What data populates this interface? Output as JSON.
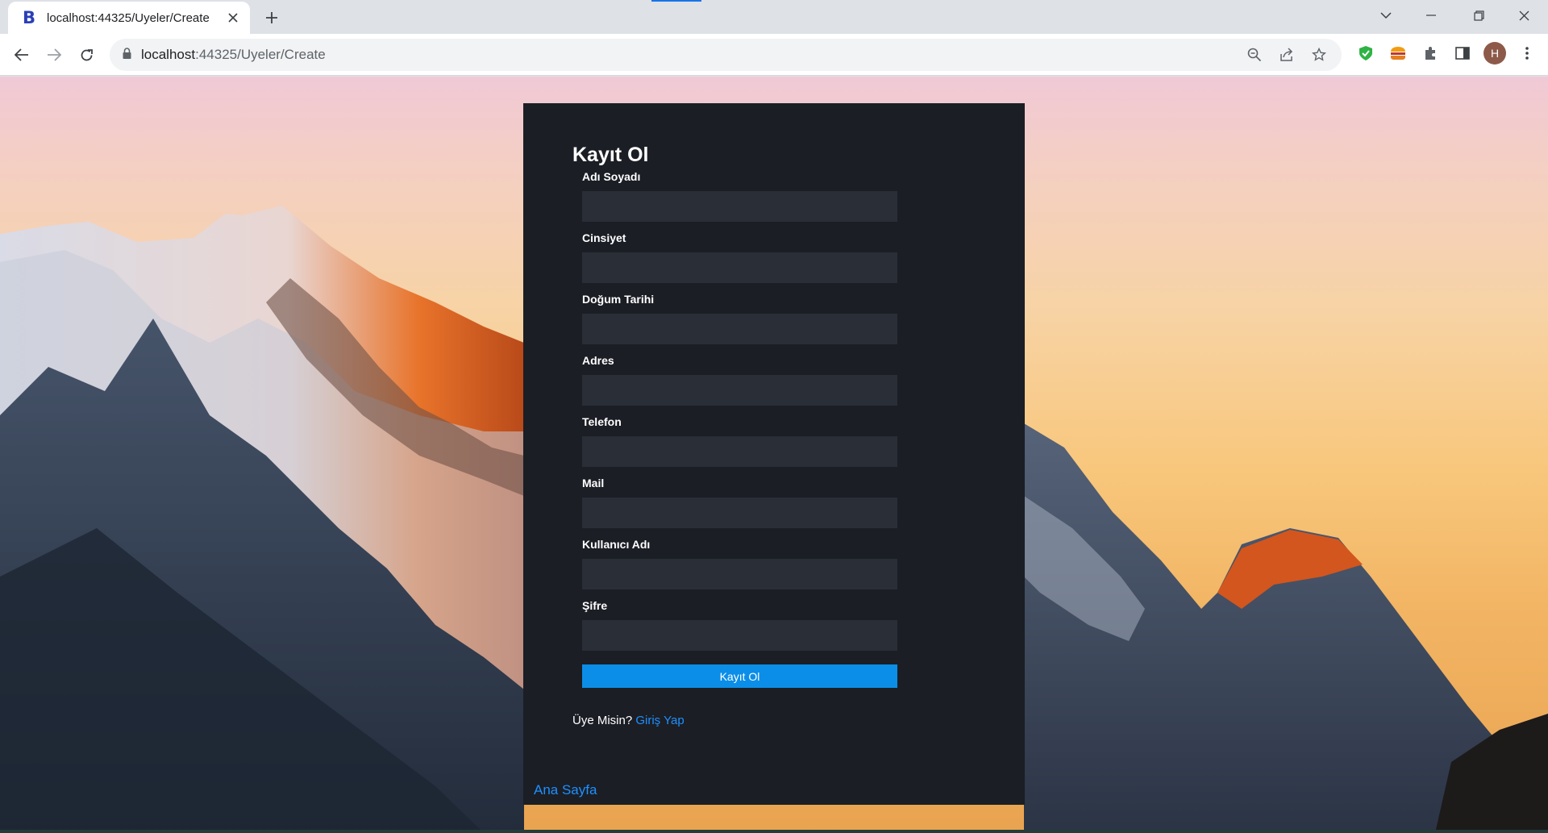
{
  "browser": {
    "tab_title": "localhost:44325/Uyeler/Create",
    "favicon_letter": "B",
    "url_host": "localhost",
    "url_path": ":44325/Uyeler/Create",
    "profile_initial": "H"
  },
  "form": {
    "title": "Kayıt Ol",
    "fields": [
      {
        "label": "Adı Soyadı",
        "value": ""
      },
      {
        "label": "Cinsiyet",
        "value": ""
      },
      {
        "label": "Doğum Tarihi",
        "value": ""
      },
      {
        "label": "Adres",
        "value": ""
      },
      {
        "label": "Telefon",
        "value": ""
      },
      {
        "label": "Mail",
        "value": ""
      },
      {
        "label": "Kullanıcı Adı",
        "value": ""
      },
      {
        "label": "Şifre",
        "value": ""
      }
    ],
    "submit_label": "Kayıt Ol",
    "member_prompt": "Üye Misin?",
    "login_link": "Giriş Yap"
  },
  "footer": {
    "home_link": "Ana Sayfa"
  },
  "colors": {
    "card_bg": "#1b1e25",
    "input_bg": "#2a2e36",
    "button_bg": "#0b8ee8",
    "link": "#1e90ff"
  }
}
